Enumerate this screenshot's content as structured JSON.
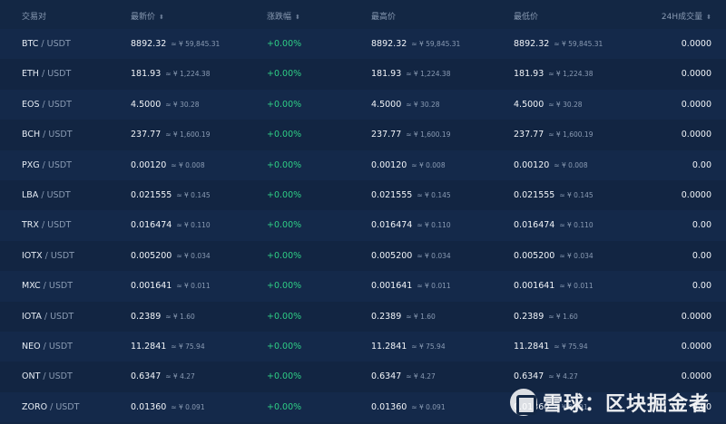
{
  "header": {
    "pair": "交易对",
    "last_price": "最新价",
    "change": "涨跌幅",
    "high": "最高价",
    "low": "最低价",
    "volume": "24H成交量",
    "sort_glyph": "⬍"
  },
  "rows": [
    {
      "base": "BTC",
      "quote": "USDT",
      "last": "8892.32",
      "last_cny": "≈ ¥ 59,845.31",
      "change": "+0.00%",
      "high": "8892.32",
      "high_cny": "≈ ¥ 59,845.31",
      "low": "8892.32",
      "low_cny": "≈ ¥ 59,845.31",
      "volume": "0.0000"
    },
    {
      "base": "ETH",
      "quote": "USDT",
      "last": "181.93",
      "last_cny": "≈ ¥ 1,224.38",
      "change": "+0.00%",
      "high": "181.93",
      "high_cny": "≈ ¥ 1,224.38",
      "low": "181.93",
      "low_cny": "≈ ¥ 1,224.38",
      "volume": "0.0000"
    },
    {
      "base": "EOS",
      "quote": "USDT",
      "last": "4.5000",
      "last_cny": "≈ ¥ 30.28",
      "change": "+0.00%",
      "high": "4.5000",
      "high_cny": "≈ ¥ 30.28",
      "low": "4.5000",
      "low_cny": "≈ ¥ 30.28",
      "volume": "0.0000"
    },
    {
      "base": "BCH",
      "quote": "USDT",
      "last": "237.77",
      "last_cny": "≈ ¥ 1,600.19",
      "change": "+0.00%",
      "high": "237.77",
      "high_cny": "≈ ¥ 1,600.19",
      "low": "237.77",
      "low_cny": "≈ ¥ 1,600.19",
      "volume": "0.0000"
    },
    {
      "base": "PXG",
      "quote": "USDT",
      "last": "0.00120",
      "last_cny": "≈ ¥ 0.008",
      "change": "+0.00%",
      "high": "0.00120",
      "high_cny": "≈ ¥ 0.008",
      "low": "0.00120",
      "low_cny": "≈ ¥ 0.008",
      "volume": "0.00"
    },
    {
      "base": "LBA",
      "quote": "USDT",
      "last": "0.021555",
      "last_cny": "≈ ¥ 0.145",
      "change": "+0.00%",
      "high": "0.021555",
      "high_cny": "≈ ¥ 0.145",
      "low": "0.021555",
      "low_cny": "≈ ¥ 0.145",
      "volume": "0.0000"
    },
    {
      "base": "TRX",
      "quote": "USDT",
      "last": "0.016474",
      "last_cny": "≈ ¥ 0.110",
      "change": "+0.00%",
      "high": "0.016474",
      "high_cny": "≈ ¥ 0.110",
      "low": "0.016474",
      "low_cny": "≈ ¥ 0.110",
      "volume": "0.00"
    },
    {
      "base": "IOTX",
      "quote": "USDT",
      "last": "0.005200",
      "last_cny": "≈ ¥ 0.034",
      "change": "+0.00%",
      "high": "0.005200",
      "high_cny": "≈ ¥ 0.034",
      "low": "0.005200",
      "low_cny": "≈ ¥ 0.034",
      "volume": "0.00"
    },
    {
      "base": "MXC",
      "quote": "USDT",
      "last": "0.001641",
      "last_cny": "≈ ¥ 0.011",
      "change": "+0.00%",
      "high": "0.001641",
      "high_cny": "≈ ¥ 0.011",
      "low": "0.001641",
      "low_cny": "≈ ¥ 0.011",
      "volume": "0.00"
    },
    {
      "base": "IOTA",
      "quote": "USDT",
      "last": "0.2389",
      "last_cny": "≈ ¥ 1.60",
      "change": "+0.00%",
      "high": "0.2389",
      "high_cny": "≈ ¥ 1.60",
      "low": "0.2389",
      "low_cny": "≈ ¥ 1.60",
      "volume": "0.0000"
    },
    {
      "base": "NEO",
      "quote": "USDT",
      "last": "11.2841",
      "last_cny": "≈ ¥ 75.94",
      "change": "+0.00%",
      "high": "11.2841",
      "high_cny": "≈ ¥ 75.94",
      "low": "11.2841",
      "low_cny": "≈ ¥ 75.94",
      "volume": "0.0000"
    },
    {
      "base": "ONT",
      "quote": "USDT",
      "last": "0.6347",
      "last_cny": "≈ ¥ 4.27",
      "change": "+0.00%",
      "high": "0.6347",
      "high_cny": "≈ ¥ 4.27",
      "low": "0.6347",
      "low_cny": "≈ ¥ 4.27",
      "volume": "0.0000"
    },
    {
      "base": "ZORO",
      "quote": "USDT",
      "last": "0.01360",
      "last_cny": "≈ ¥ 0.091",
      "change": "+0.00%",
      "high": "0.01360",
      "high_cny": "≈ ¥ 0.091",
      "low": "0.01360",
      "low_cny": "≈ ¥ 0.091",
      "volume": "0.00"
    }
  ],
  "watermark": {
    "text": "雪球：区块掘金者"
  },
  "colors": {
    "background": "#132744",
    "positive": "#2fcf86",
    "muted": "#8a9bb3"
  }
}
